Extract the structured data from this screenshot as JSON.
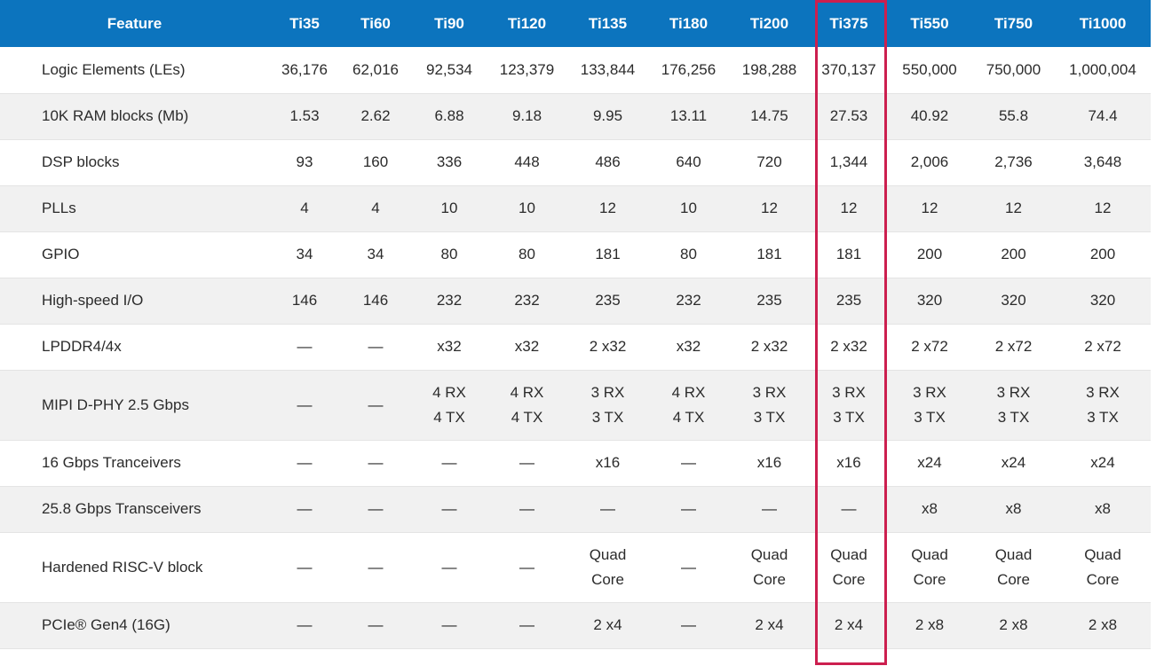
{
  "table": {
    "headers": [
      "Feature",
      "Ti35",
      "Ti60",
      "Ti90",
      "Ti120",
      "Ti135",
      "Ti180",
      "Ti200",
      "Ti375",
      "Ti550",
      "Ti750",
      "Ti1000"
    ],
    "rows": [
      {
        "feature": "Logic Elements (LEs)",
        "values": [
          "36,176",
          "62,016",
          "92,534",
          "123,379",
          "133,844",
          "176,256",
          "198,288",
          "370,137",
          "550,000",
          "750,000",
          "1,000,004"
        ]
      },
      {
        "feature": "10K RAM blocks (Mb)",
        "values": [
          "1.53",
          "2.62",
          "6.88",
          "9.18",
          "9.95",
          "13.11",
          "14.75",
          "27.53",
          "40.92",
          "55.8",
          "74.4"
        ]
      },
      {
        "feature": "DSP blocks",
        "values": [
          "93",
          "160",
          "336",
          "448",
          "486",
          "640",
          "720",
          "1,344",
          "2,006",
          "2,736",
          "3,648"
        ]
      },
      {
        "feature": "PLLs",
        "values": [
          "4",
          "4",
          "10",
          "10",
          "12",
          "10",
          "12",
          "12",
          "12",
          "12",
          "12"
        ]
      },
      {
        "feature": "GPIO",
        "values": [
          "34",
          "34",
          "80",
          "80",
          "181",
          "80",
          "181",
          "181",
          "200",
          "200",
          "200"
        ]
      },
      {
        "feature": "High-speed I/O",
        "values": [
          "146",
          "146",
          "232",
          "232",
          "235",
          "232",
          "235",
          "235",
          "320",
          "320",
          "320"
        ]
      },
      {
        "feature": "LPDDR4/4x",
        "values": [
          "—",
          "—",
          "x32",
          "x32",
          "2 x32",
          "x32",
          "2 x32",
          "2 x32",
          "2 x72",
          "2 x72",
          "2 x72"
        ]
      },
      {
        "feature": "MIPI D-PHY 2.5 Gbps",
        "values": [
          "—",
          "—",
          "4 RX\n4 TX",
          "4 RX\n4 TX",
          "3 RX\n3 TX",
          "4 RX\n4 TX",
          "3 RX\n3 TX",
          "3 RX\n3 TX",
          "3 RX\n3 TX",
          "3 RX\n3 TX",
          "3 RX\n3 TX"
        ]
      },
      {
        "feature": "16 Gbps Tranceivers",
        "values": [
          "—",
          "—",
          "—",
          "—",
          "x16",
          "—",
          "x16",
          "x16",
          "x24",
          "x24",
          "x24"
        ]
      },
      {
        "feature": "25.8 Gbps Transceivers",
        "values": [
          "—",
          "—",
          "—",
          "—",
          "—",
          "—",
          "—",
          "—",
          "x8",
          "x8",
          "x8"
        ]
      },
      {
        "feature": "Hardened RISC-V block",
        "values": [
          "—",
          "—",
          "—",
          "—",
          "Quad\nCore",
          "—",
          "Quad\nCore",
          "Quad\nCore",
          "Quad\nCore",
          "Quad\nCore",
          "Quad\nCore"
        ]
      },
      {
        "feature": "PCIe® Gen4 (16G)",
        "values": [
          "—",
          "—",
          "—",
          "—",
          "2 x4",
          "—",
          "2 x4",
          "2 x4",
          "2 x8",
          "2 x8",
          "2 x8"
        ]
      }
    ]
  },
  "highlighted_column": "Ti375",
  "colors": {
    "header_bg": "#0c74be",
    "header_text": "#ffffff",
    "row_alt_bg": "#f1f1f1",
    "highlight_border": "#cc1f4f"
  }
}
